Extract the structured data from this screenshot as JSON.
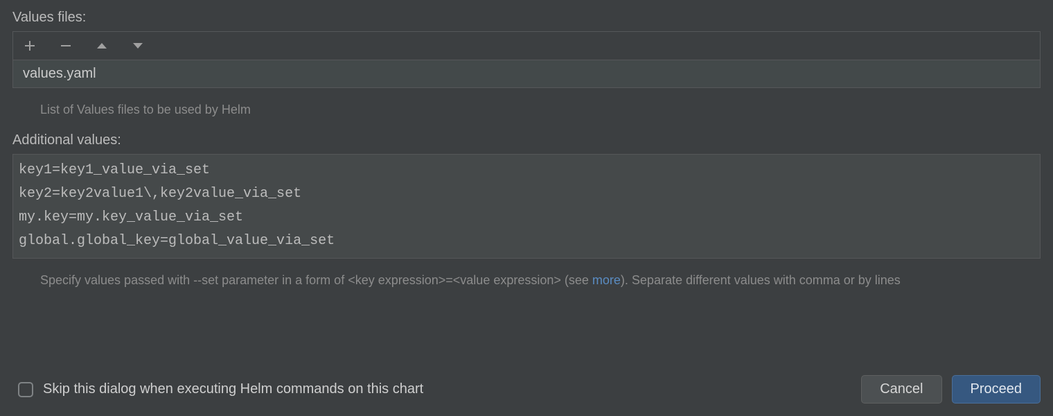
{
  "values_files": {
    "label": "Values files:",
    "items": [
      "values.yaml"
    ],
    "hint": "List of Values files to be used by Helm"
  },
  "additional_values": {
    "label": "Additional values:",
    "value": "key1=key1_value_via_set\nkey2=key2value1\\,key2value_via_set\nmy.key=my.key_value_via_set\nglobal.global_key=global_value_via_set",
    "hint_pre": "Specify values passed with --set parameter in a form of <key expression>=<value expression> (see ",
    "hint_link": "more",
    "hint_post": "). Separate different values with comma or by lines"
  },
  "footer": {
    "skip_label": "Skip this dialog when executing Helm commands on this chart",
    "skip_checked": false,
    "cancel": "Cancel",
    "proceed": "Proceed"
  },
  "icons": {
    "add": "add-icon",
    "remove": "remove-icon",
    "up": "up-icon",
    "down": "down-icon"
  }
}
